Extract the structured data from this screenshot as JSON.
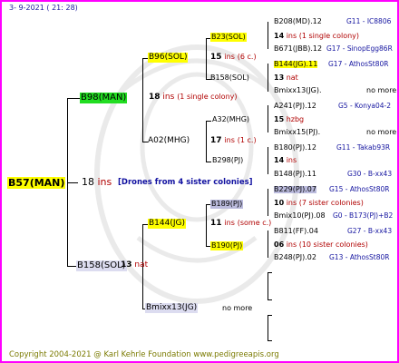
{
  "header": "3-  9-2021 ( 21: 28)",
  "footer": "Copyright 2004-2021 @ Karl Kehrle Foundation    www.pedigreeapis.org",
  "root": {
    "label": "B57(MAN)",
    "num": "18",
    "ins": "ins",
    "note": "[Drones from 4 sister colonies]"
  },
  "gen1": {
    "upper": {
      "label": "B98(MAN)",
      "num": "18",
      "ins": "ins",
      "note": "(1 single colony)"
    },
    "lower": {
      "label": "B158(SOL)",
      "num": "13",
      "ins": "nat"
    }
  },
  "gen2": {
    "a": {
      "label": "B96(SOL)",
      "num": "15",
      "ins": "ins",
      "note": "(6 c.)"
    },
    "b": {
      "label": "A02(MHG)",
      "num": "17",
      "ins": "ins",
      "note": "(1 c.)"
    },
    "c": {
      "label": "B144(JG)",
      "num": "11",
      "ins": "ins",
      "note": "(some c.)"
    },
    "d": {
      "label": "Bmixx13(JG)",
      "note": "no more"
    }
  },
  "gen3": {
    "a1": {
      "label": "B23(SOL)",
      "num": "14",
      "ins": "ins",
      "note": "(1 single colony)"
    },
    "a2": {
      "label": "B158(SOL)",
      "num": "13",
      "ins": "nat"
    },
    "b1": {
      "label": "A32(MHG)",
      "num": "15",
      "ins": "hzbg"
    },
    "b2": {
      "label": "B298(PJ)",
      "num": "14",
      "ins": "ins"
    },
    "c1": {
      "label": "B189(PJ)",
      "num": "10",
      "ins": "ins",
      "note": "(7 sister colonies)"
    },
    "c2": {
      "label": "B190(PJ)",
      "num": "06",
      "ins": "ins",
      "note": "(10 sister colonies)"
    }
  },
  "gen4": [
    {
      "label": "B208(MD).12",
      "info": "G11 - IC8806"
    },
    {
      "label": "B671(JBB).12",
      "info": "G17 - SinopEgg86R"
    },
    {
      "label": "B144(JG).11",
      "info": "G17 - AthosSt80R"
    },
    {
      "label": "Bmixx13(JG).",
      "info": "no more"
    },
    {
      "label": "A241(PJ).12",
      "info": "G5 - Konya04-2"
    },
    {
      "label": "Bmixx15(PJ).",
      "info": "no more"
    },
    {
      "label": "B180(PJ).12",
      "info": "G11 - Takab93R"
    },
    {
      "label": "B148(PJ).11",
      "info": "G30 - B-xx43"
    },
    {
      "label": "B229(PJ).07",
      "info": "G15 - AthosSt80R"
    },
    {
      "label": "Bmix10(PJ).08",
      "info": "G0 - B173(PJ)+B2"
    },
    {
      "label": "B811(FF).04",
      "info": "G27 - B-xx43"
    },
    {
      "label": "B248(PJ).02",
      "info": "G13 - AthosSt80R"
    }
  ],
  "colors": {
    "frame": "#ff00ff",
    "highlight_yellow": "#ffff00",
    "highlight_green": "#22dd22",
    "highlight_violet": "#bbbbdd",
    "text_red": "#b00000",
    "text_blue": "#1010a0",
    "footer": "#7a7a00"
  }
}
